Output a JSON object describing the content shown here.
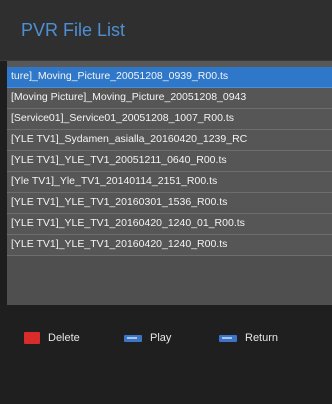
{
  "title": "PVR File List",
  "files": [
    "ture]_Moving_Picture_20051208_0939_R00.ts",
    "[Moving Picture]_Moving_Picture_20051208_0943",
    "[Service01]_Service01_20051208_1007_R00.ts",
    "[YLE TV1]_Sydamen_asialla_20160420_1239_RC",
    "[YLE TV1]_YLE_TV1_20051211_0640_R00.ts",
    "[Yle TV1]_Yle_TV1_20140114_2151_R00.ts",
    "[YLE TV1]_YLE_TV1_20160301_1536_R00.ts",
    "[YLE TV1]_YLE_TV1_20160420_1240_01_R00.ts",
    "[YLE TV1]_YLE_TV1_20160420_1240_R00.ts"
  ],
  "selected_index": 0,
  "footer": {
    "delete_label": "Delete",
    "play_label": "Play",
    "return_label": "Return",
    "delete_color": "#d82b2b",
    "key_color": "#3c74c6"
  },
  "colors": {
    "title": "#4e8fd3",
    "selected_row": "#2f78c9",
    "row": "#565656"
  }
}
